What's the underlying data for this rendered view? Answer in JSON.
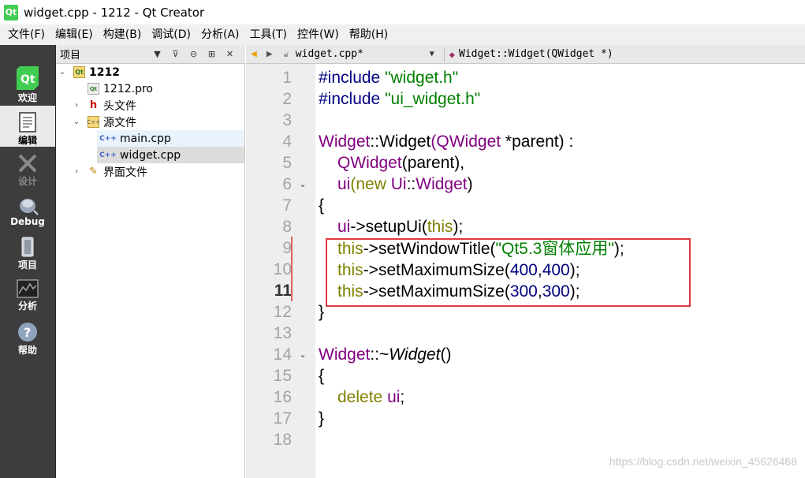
{
  "window": {
    "title": "widget.cpp - 1212 - Qt Creator",
    "icon_text": "Qt"
  },
  "menu": [
    "文件(F)",
    "编辑(E)",
    "构建(B)",
    "调试(D)",
    "分析(A)",
    "工具(T)",
    "控件(W)",
    "帮助(H)"
  ],
  "modes": [
    {
      "label": "欢迎",
      "icon": "qt-logo-icon"
    },
    {
      "label": "编辑",
      "icon": "edit-document-icon"
    },
    {
      "label": "设计",
      "icon": "design-icon"
    },
    {
      "label": "Debug",
      "icon": "debug-bug-icon"
    },
    {
      "label": "项目",
      "icon": "project-icon"
    },
    {
      "label": "分析",
      "icon": "analyze-icon"
    },
    {
      "label": "帮助",
      "icon": "help-icon"
    }
  ],
  "project_panel": {
    "title": "项目",
    "tree": [
      {
        "label": "1212",
        "type": "project"
      },
      {
        "label": "1212.pro",
        "type": "pro-file"
      },
      {
        "label": "头文件",
        "type": "headers"
      },
      {
        "label": "源文件",
        "type": "sources"
      },
      {
        "label": "main.cpp",
        "type": "cpp"
      },
      {
        "label": "widget.cpp",
        "type": "cpp"
      },
      {
        "label": "界面文件",
        "type": "forms"
      }
    ]
  },
  "editor": {
    "file": "widget.cpp*",
    "symbol": "Widget::Widget(QWidget *)",
    "current_line": 11,
    "line_numbers": [
      "1",
      "2",
      "3",
      "4",
      "5",
      "6",
      "7",
      "8",
      "9",
      "10",
      "11",
      "12",
      "13",
      "14",
      "15",
      "16",
      "17",
      "18"
    ],
    "code": {
      "l1_pre": "#include ",
      "l1_str": "\"widget.h\"",
      "l2_pre": "#include ",
      "l2_str": "\"ui_widget.h\"",
      "l4_a": "Widget",
      "l4_b": "::",
      "l4_c": "Widget",
      "l4_d": "(",
      "l4_e": "QWidget",
      "l4_f": " *parent) :",
      "l5_a": "QWidget",
      "l5_b": "(parent),",
      "l6_a": "ui",
      "l6_b": "(",
      "l6_c": "new",
      "l6_d": " ",
      "l6_e": "Ui",
      "l6_f": "::",
      "l6_g": "Widget",
      "l6_h": ")",
      "l7": "{",
      "l8_a": "ui",
      "l8_b": "->setupUi(",
      "l8_c": "this",
      "l8_d": ");",
      "l9_a": "this",
      "l9_b": "->setWindowTitle(",
      "l9_c": "\"Qt5.3窗体应用\"",
      "l9_d": ");",
      "l10_a": "this",
      "l10_b": "->setMaximumSize(",
      "l10_c": "400",
      "l10_d": ",",
      "l10_e": "400",
      "l10_f": ");",
      "l11_a": "this",
      "l11_b": "->setMaximumSize(",
      "l11_c": "300",
      "l11_d": ",",
      "l11_e": "300",
      "l11_f": ");",
      "l12": "}",
      "l14_a": "Widget",
      "l14_b": "::~",
      "l14_c": "Widget",
      "l14_d": "()",
      "l15": "{",
      "l16_a": "delete",
      "l16_b": " ",
      "l16_c": "ui",
      "l16_d": ";",
      "l17": "}"
    }
  },
  "watermark": "https://blog.csdn.net/weixin_45626468",
  "colors": {
    "keyword": "#808000",
    "string": "#008000",
    "type": "#800080",
    "number": "#000080",
    "highlight_box": "#e0393e"
  }
}
